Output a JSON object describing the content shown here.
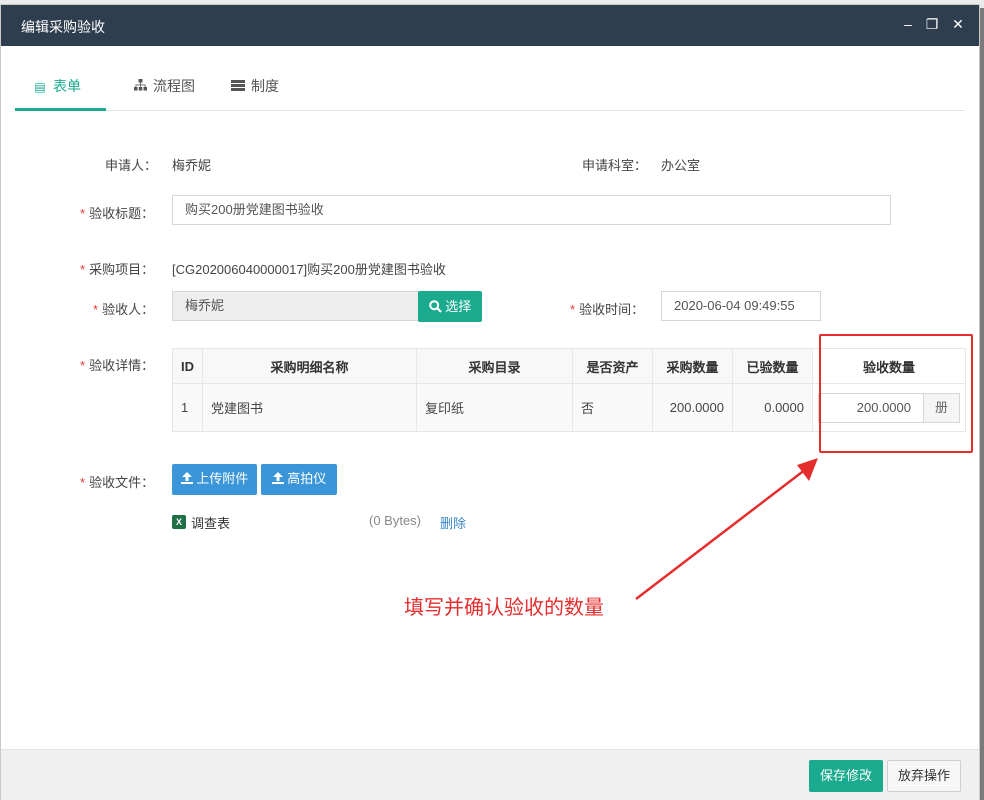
{
  "dialog": {
    "title": "编辑采购验收",
    "controls": {
      "minimize": "–",
      "maximize": "❐",
      "close": "✕"
    }
  },
  "tabs": [
    {
      "label": "表单",
      "icon": "form-icon",
      "active": true
    },
    {
      "label": "流程图",
      "icon": "flowchart-icon",
      "active": false
    },
    {
      "label": "制度",
      "icon": "policy-icon",
      "active": false
    }
  ],
  "form": {
    "applicant_label": "申请人：",
    "applicant_value": "梅乔妮",
    "department_label": "申请科室：",
    "department_value": "办公室",
    "required_mark": "*",
    "title_label": "验收标题：",
    "title_value": "购买200册党建图书验收",
    "project_label": "采购项目：",
    "project_value": "[CG202006040000017]购买200册党建图书验收",
    "inspector_label": "验收人：",
    "inspector_value": "梅乔妮",
    "select_button": "选择",
    "time_label": "验收时间：",
    "time_value": "2020-06-04 09:49:55",
    "detail_label": "验收详情：",
    "files_label": "验收文件："
  },
  "table": {
    "headers": [
      "ID",
      "采购明细名称",
      "采购目录",
      "是否资产",
      "采购数量",
      "已验数量",
      "验收数量"
    ],
    "rows": [
      {
        "id": "1",
        "name": "党建图书",
        "catalog": "复印纸",
        "is_asset": "否",
        "purchase_qty": "200.0000",
        "checked_qty": "0.0000",
        "accept_qty": "200.0000",
        "unit": "册"
      }
    ]
  },
  "files": {
    "upload_button": "上传附件",
    "camera_button": "高拍仪",
    "items": [
      {
        "name": "调查表",
        "size": "(0 Bytes)",
        "delete": "删除",
        "icon": "excel-icon"
      }
    ]
  },
  "annotation": {
    "text": "填写并确认验收的数量",
    "color": "#e52d2d"
  },
  "footer": {
    "save_button": "保存修改",
    "discard_button": "放弃操作"
  },
  "colors": {
    "accent": "#1aaa8e",
    "titlebar": "#2e3e4e",
    "button_blue": "#3a96d8"
  }
}
